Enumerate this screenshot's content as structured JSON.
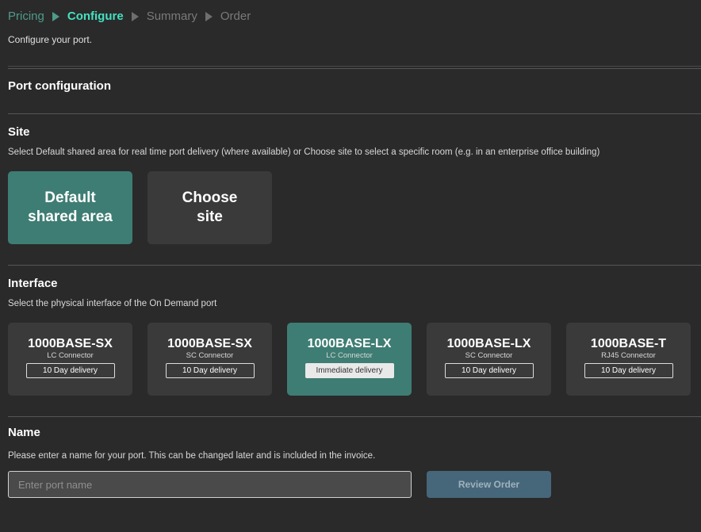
{
  "breadcrumb": {
    "steps": [
      {
        "label": "Pricing",
        "state": "visited"
      },
      {
        "label": "Configure",
        "state": "active"
      },
      {
        "label": "Summary",
        "state": "upcoming"
      },
      {
        "label": "Order",
        "state": "upcoming"
      }
    ]
  },
  "header": {
    "subtitle": "Configure your port."
  },
  "port_config": {
    "title": "Port configuration"
  },
  "site": {
    "title": "Site",
    "description": "Select Default shared area for real time port delivery (where available) or Choose site to select a specific room (e.g. in an enterprise office building)",
    "options": [
      {
        "label_line1": "Default",
        "label_line2": "shared area",
        "selected": true
      },
      {
        "label_line1": "Choose",
        "label_line2": "site",
        "selected": false
      }
    ]
  },
  "interface": {
    "title": "Interface",
    "description": "Select the physical interface of the On Demand port",
    "options": [
      {
        "name": "1000BASE-SX",
        "connector": "LC Connector",
        "delivery": "10 Day delivery",
        "selected": false
      },
      {
        "name": "1000BASE-SX",
        "connector": "SC Connector",
        "delivery": "10 Day delivery",
        "selected": false
      },
      {
        "name": "1000BASE-LX",
        "connector": "LC Connector",
        "delivery": "Immediate delivery",
        "selected": true
      },
      {
        "name": "1000BASE-LX",
        "connector": "SC Connector",
        "delivery": "10 Day delivery",
        "selected": false
      },
      {
        "name": "1000BASE-T",
        "connector": "RJ45 Connector",
        "delivery": "10 Day delivery",
        "selected": false
      }
    ]
  },
  "name": {
    "title": "Name",
    "description": "Please enter a name for your port. This can be changed later and is included in the invoice.",
    "input_value": "",
    "input_placeholder": "Enter port name",
    "review_button_label": "Review Order"
  },
  "colors": {
    "background": "#2a2a2a",
    "accent_active": "#45e0c0",
    "selected_card": "#3e7d73",
    "card": "#3a3a3a",
    "button_disabled": "#46677a"
  }
}
